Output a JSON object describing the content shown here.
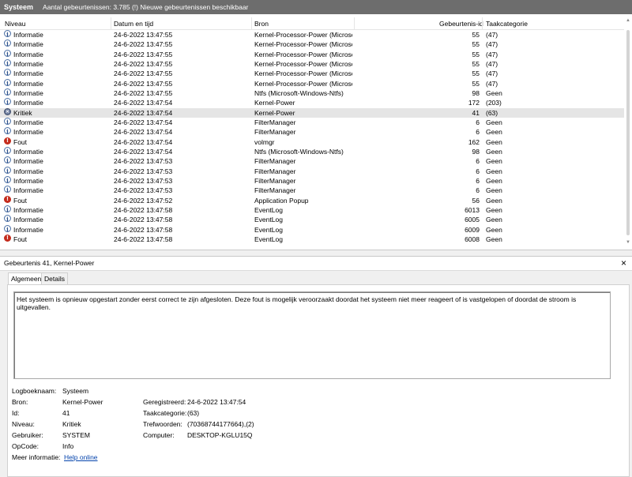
{
  "titlebar": {
    "title": "Systeem",
    "info": "Aantal gebeurtenissen: 3.785 (!) Nieuwe gebeurtenissen beschikbaar"
  },
  "columns": {
    "level": "Niveau",
    "date": "Datum en tijd",
    "source": "Bron",
    "id": "Gebeurtenis-id",
    "category": "Taakcategorie"
  },
  "events": [
    {
      "level": "Informatie",
      "icon": "info",
      "date": "24-6-2022 13:47:55",
      "source": "Kernel-Processor-Power (Microso...",
      "id": "55",
      "category": "(47)",
      "selected": false
    },
    {
      "level": "Informatie",
      "icon": "info",
      "date": "24-6-2022 13:47:55",
      "source": "Kernel-Processor-Power (Microso...",
      "id": "55",
      "category": "(47)",
      "selected": false
    },
    {
      "level": "Informatie",
      "icon": "info",
      "date": "24-6-2022 13:47:55",
      "source": "Kernel-Processor-Power (Microso...",
      "id": "55",
      "category": "(47)",
      "selected": false
    },
    {
      "level": "Informatie",
      "icon": "info",
      "date": "24-6-2022 13:47:55",
      "source": "Kernel-Processor-Power (Microso...",
      "id": "55",
      "category": "(47)",
      "selected": false
    },
    {
      "level": "Informatie",
      "icon": "info",
      "date": "24-6-2022 13:47:55",
      "source": "Kernel-Processor-Power (Microso...",
      "id": "55",
      "category": "(47)",
      "selected": false
    },
    {
      "level": "Informatie",
      "icon": "info",
      "date": "24-6-2022 13:47:55",
      "source": "Kernel-Processor-Power (Microso...",
      "id": "55",
      "category": "(47)",
      "selected": false
    },
    {
      "level": "Informatie",
      "icon": "info",
      "date": "24-6-2022 13:47:55",
      "source": "Ntfs (Microsoft-Windows-Ntfs)",
      "id": "98",
      "category": "Geen",
      "selected": false
    },
    {
      "level": "Informatie",
      "icon": "info",
      "date": "24-6-2022 13:47:54",
      "source": "Kernel-Power",
      "id": "172",
      "category": "(203)",
      "selected": false
    },
    {
      "level": "Kritiek",
      "icon": "crit",
      "date": "24-6-2022 13:47:54",
      "source": "Kernel-Power",
      "id": "41",
      "category": "(63)",
      "selected": true
    },
    {
      "level": "Informatie",
      "icon": "info",
      "date": "24-6-2022 13:47:54",
      "source": "FilterManager",
      "id": "6",
      "category": "Geen",
      "selected": false
    },
    {
      "level": "Informatie",
      "icon": "info",
      "date": "24-6-2022 13:47:54",
      "source": "FilterManager",
      "id": "6",
      "category": "Geen",
      "selected": false
    },
    {
      "level": "Fout",
      "icon": "err",
      "date": "24-6-2022 13:47:54",
      "source": "volmgr",
      "id": "162",
      "category": "Geen",
      "selected": false
    },
    {
      "level": "Informatie",
      "icon": "info",
      "date": "24-6-2022 13:47:54",
      "source": "Ntfs (Microsoft-Windows-Ntfs)",
      "id": "98",
      "category": "Geen",
      "selected": false
    },
    {
      "level": "Informatie",
      "icon": "info",
      "date": "24-6-2022 13:47:53",
      "source": "FilterManager",
      "id": "6",
      "category": "Geen",
      "selected": false
    },
    {
      "level": "Informatie",
      "icon": "info",
      "date": "24-6-2022 13:47:53",
      "source": "FilterManager",
      "id": "6",
      "category": "Geen",
      "selected": false
    },
    {
      "level": "Informatie",
      "icon": "info",
      "date": "24-6-2022 13:47:53",
      "source": "FilterManager",
      "id": "6",
      "category": "Geen",
      "selected": false
    },
    {
      "level": "Informatie",
      "icon": "info",
      "date": "24-6-2022 13:47:53",
      "source": "FilterManager",
      "id": "6",
      "category": "Geen",
      "selected": false
    },
    {
      "level": "Fout",
      "icon": "err",
      "date": "24-6-2022 13:47:52",
      "source": "Application Popup",
      "id": "56",
      "category": "Geen",
      "selected": false
    },
    {
      "level": "Informatie",
      "icon": "info",
      "date": "24-6-2022 13:47:58",
      "source": "EventLog",
      "id": "6013",
      "category": "Geen",
      "selected": false
    },
    {
      "level": "Informatie",
      "icon": "info",
      "date": "24-6-2022 13:47:58",
      "source": "EventLog",
      "id": "6005",
      "category": "Geen",
      "selected": false
    },
    {
      "level": "Informatie",
      "icon": "info",
      "date": "24-6-2022 13:47:58",
      "source": "EventLog",
      "id": "6009",
      "category": "Geen",
      "selected": false
    },
    {
      "level": "Fout",
      "icon": "err",
      "date": "24-6-2022 13:47:58",
      "source": "EventLog",
      "id": "6008",
      "category": "Geen",
      "selected": false
    }
  ],
  "details": {
    "title": "Gebeurtenis 41, Kernel-Power",
    "close": "×",
    "tabs": [
      "Algemeen",
      "Details"
    ],
    "message": "Het systeem is opnieuw opgestart zonder eerst correct te zijn afgesloten. Deze fout is mogelijk veroorzaakt doordat het systeem niet meer reageert of is vastgelopen of doordat de stroom is uitgevallen.",
    "fields": {
      "logname_label": "Logboeknaam:",
      "logname": "Systeem",
      "source_label": "Bron:",
      "source": "Kernel-Power",
      "logged_label": "Geregistreerd:",
      "logged": "24-6-2022 13:47:54",
      "id_label": "Id:",
      "id": "41",
      "category_label": "Taakcategorie:",
      "category": "(63)",
      "level_label": "Niveau:",
      "level": "Kritiek",
      "keywords_label": "Trefwoorden:",
      "keywords": "(70368744177664),(2)",
      "user_label": "Gebruiker:",
      "user": "SYSTEM",
      "computer_label": "Computer:",
      "computer": "DESKTOP-KGLU15Q",
      "opcode_label": "OpCode:",
      "opcode": "Info",
      "moreinfo_label": "Meer informatie:",
      "moreinfo_link": "Help online"
    }
  },
  "colors": {
    "titlebar": "#6d6d6d",
    "selected_row": "#e5e5e5",
    "error": "#c42b1c",
    "link": "#0645ad"
  }
}
